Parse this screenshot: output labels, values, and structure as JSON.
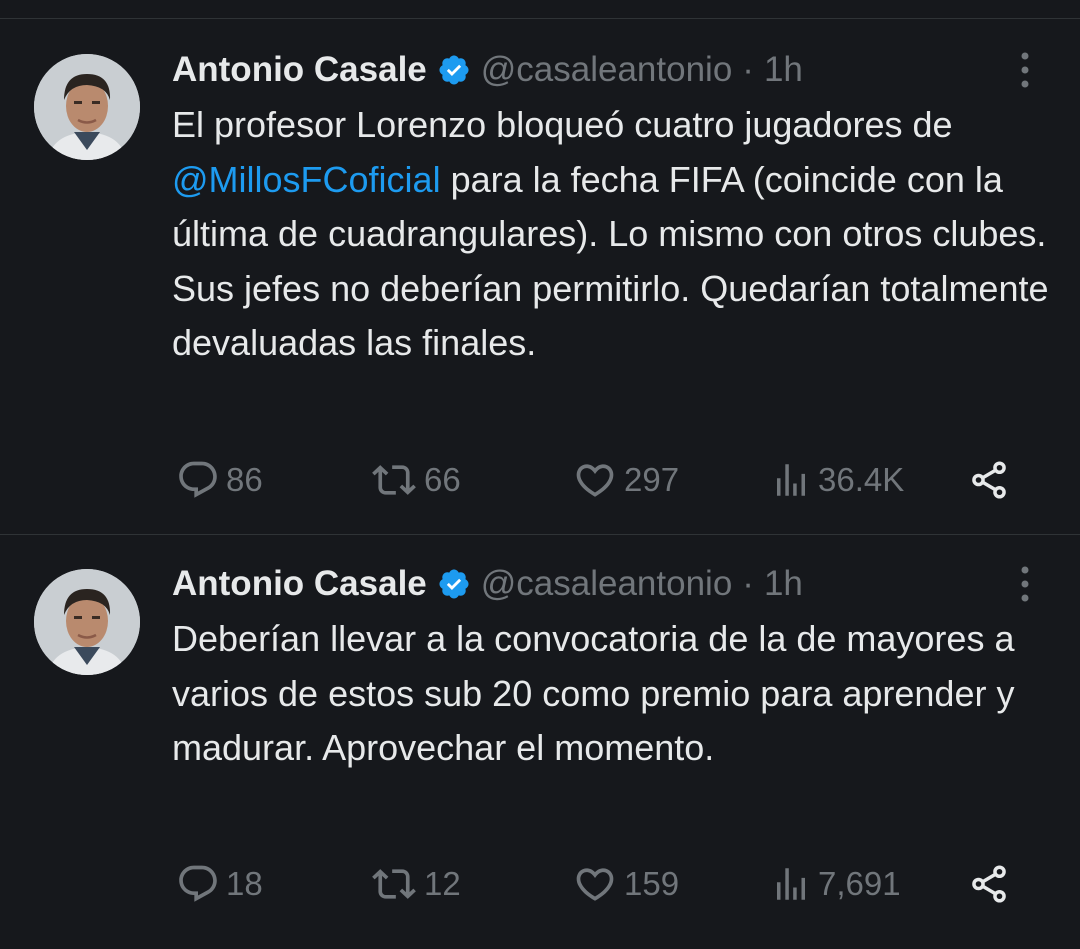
{
  "colors": {
    "background": "#16181c",
    "text": "#e7e9ea",
    "muted": "#71767b",
    "link": "#1d9bf0",
    "verified": "#1d9bf0"
  },
  "tweets": [
    {
      "author_name": "Antonio Casale",
      "handle": "@casaleantonio",
      "separator": "·",
      "time": "1h",
      "text_before": "El profesor Lorenzo bloqueó cuatro jugadores de ",
      "mention": "@MillosFCoficial",
      "text_after": " para la fecha FIFA (coincide con la última de cuadrangulares). Lo mismo con otros clubes. Sus jefes no deberían permitirlo. Quedarían totalmente devaluadas las finales.",
      "replies": "86",
      "reposts": "66",
      "likes": "297",
      "views": "36.4K",
      "icons": [
        "verified-badge-icon",
        "more-options-icon",
        "reply-icon",
        "repost-icon",
        "like-icon",
        "views-icon",
        "share-icon"
      ]
    },
    {
      "author_name": "Antonio Casale",
      "handle": "@casaleantonio",
      "separator": "·",
      "time": "1h",
      "text": "Deberían llevar a la convocatoria de la de mayores  a varios de estos sub 20 como premio para aprender y madurar. Aprovechar el momento.",
      "replies": "18",
      "reposts": "12",
      "likes": "159",
      "views": "7,691",
      "icons": [
        "verified-badge-icon",
        "more-options-icon",
        "reply-icon",
        "repost-icon",
        "like-icon",
        "views-icon",
        "share-icon"
      ]
    }
  ]
}
